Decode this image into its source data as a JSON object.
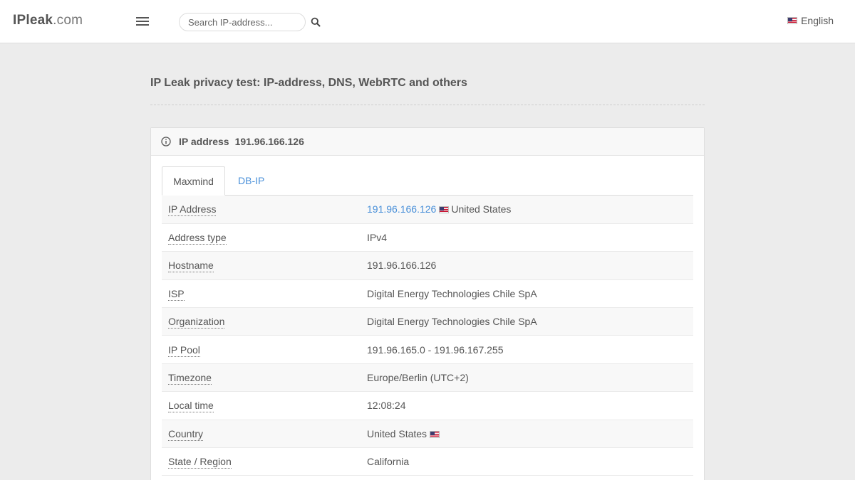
{
  "header": {
    "logo_main": "IPleak",
    "logo_domain": ".com",
    "search_placeholder": "Search IP-address...",
    "language": "English"
  },
  "page": {
    "title": "IP Leak privacy test: IP-address, DNS, WebRTC and others"
  },
  "card": {
    "label": "IP address",
    "ip": "191.96.166.126",
    "tabs": [
      "Maxmind",
      "DB-IP"
    ],
    "rows": [
      {
        "key": "IP Address",
        "value": "191.96.166.126",
        "country": "United States"
      },
      {
        "key": "Address type",
        "value": "IPv4"
      },
      {
        "key": "Hostname",
        "value": "191.96.166.126"
      },
      {
        "key": "ISP",
        "value": "Digital Energy Technologies Chile SpA"
      },
      {
        "key": "Organization",
        "value": "Digital Energy Technologies Chile SpA"
      },
      {
        "key": "IP Pool",
        "value": "191.96.165.0 - 191.96.167.255"
      },
      {
        "key": "Timezone",
        "value": "Europe/Berlin (UTC+2)"
      },
      {
        "key": "Local time",
        "value": "12:08:24"
      },
      {
        "key": "Country",
        "value": "United States"
      },
      {
        "key": "State / Region",
        "value": "California"
      }
    ]
  },
  "icons": {
    "menu": "hamburger-menu-icon",
    "search": "search-icon",
    "flag": "us-flag-icon",
    "info": "info-icon"
  },
  "colors": {
    "link": "#4a90d9",
    "background": "#ececec"
  }
}
